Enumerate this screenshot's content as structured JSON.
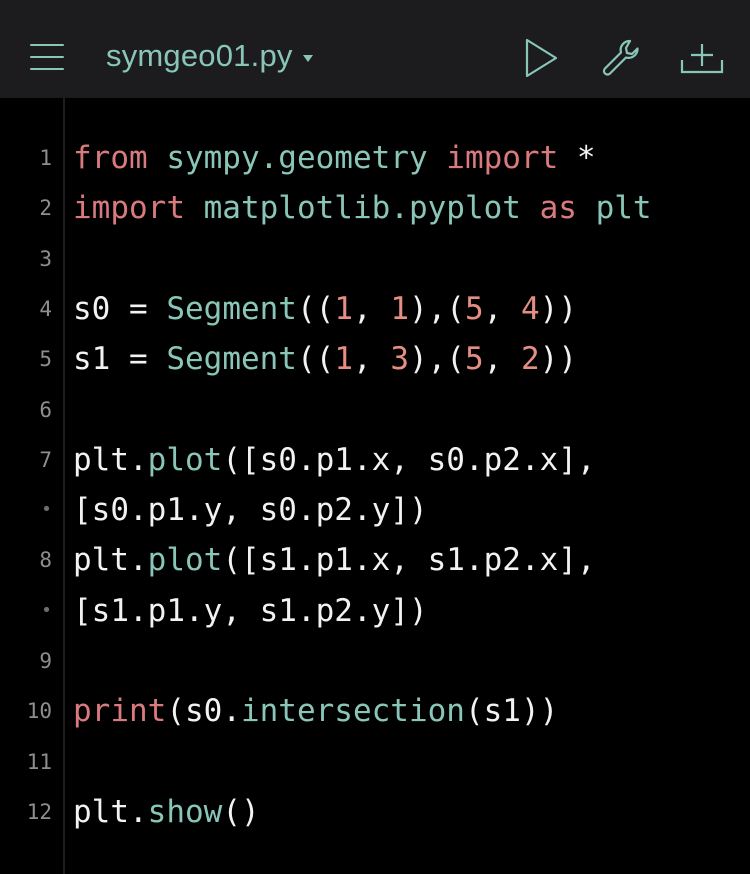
{
  "toolbar": {
    "filename": "symgeo01.py",
    "icons": [
      "hamburger-menu-icon",
      "play-icon",
      "wrench-icon",
      "add-file-icon"
    ],
    "accent_color": "#8ac6b8"
  },
  "editor": {
    "line_numbers": [
      "1",
      "2",
      "3",
      "4",
      "5",
      "6",
      "7",
      "•",
      "8",
      "•",
      "9",
      "10",
      "11",
      "12"
    ],
    "lines": [
      [
        {
          "t": "from",
          "c": "kw"
        },
        {
          "t": " sympy.geometry ",
          "c": "fn"
        },
        {
          "t": "import",
          "c": "kw"
        },
        {
          "t": " *",
          "c": "plain"
        }
      ],
      [
        {
          "t": "import",
          "c": "kw"
        },
        {
          "t": " matplotlib.pyplot ",
          "c": "fn"
        },
        {
          "t": "as",
          "c": "kw"
        },
        {
          "t": " plt",
          "c": "fn"
        }
      ],
      [],
      [
        {
          "t": "s0 = ",
          "c": "plain"
        },
        {
          "t": "Segment",
          "c": "fn"
        },
        {
          "t": "((",
          "c": "plain"
        },
        {
          "t": "1",
          "c": "num"
        },
        {
          "t": ", ",
          "c": "plain"
        },
        {
          "t": "1",
          "c": "num"
        },
        {
          "t": "),(",
          "c": "plain"
        },
        {
          "t": "5",
          "c": "num"
        },
        {
          "t": ", ",
          "c": "plain"
        },
        {
          "t": "4",
          "c": "num"
        },
        {
          "t": "))",
          "c": "plain"
        }
      ],
      [
        {
          "t": "s1 = ",
          "c": "plain"
        },
        {
          "t": "Segment",
          "c": "fn"
        },
        {
          "t": "((",
          "c": "plain"
        },
        {
          "t": "1",
          "c": "num"
        },
        {
          "t": ", ",
          "c": "plain"
        },
        {
          "t": "3",
          "c": "num"
        },
        {
          "t": "),(",
          "c": "plain"
        },
        {
          "t": "5",
          "c": "num"
        },
        {
          "t": ", ",
          "c": "plain"
        },
        {
          "t": "2",
          "c": "num"
        },
        {
          "t": "))",
          "c": "plain"
        }
      ],
      [],
      [
        {
          "t": "plt.",
          "c": "plain"
        },
        {
          "t": "plot",
          "c": "fn"
        },
        {
          "t": "([s0.p1.x, s0.p2.x],",
          "c": "plain"
        }
      ],
      [
        {
          "t": "[s0.p1.y, s0.p2.y])",
          "c": "plain"
        }
      ],
      [
        {
          "t": "plt.",
          "c": "plain"
        },
        {
          "t": "plot",
          "c": "fn"
        },
        {
          "t": "([s1.p1.x, s1.p2.x],",
          "c": "plain"
        }
      ],
      [
        {
          "t": "[s1.p1.y, s1.p2.y])",
          "c": "plain"
        }
      ],
      [],
      [
        {
          "t": "print",
          "c": "kw"
        },
        {
          "t": "(s0.",
          "c": "plain"
        },
        {
          "t": "intersection",
          "c": "fn"
        },
        {
          "t": "(s1))",
          "c": "plain"
        }
      ],
      [],
      [
        {
          "t": "plt.",
          "c": "plain"
        },
        {
          "t": "show",
          "c": "fn"
        },
        {
          "t": "()",
          "c": "plain"
        }
      ]
    ]
  }
}
